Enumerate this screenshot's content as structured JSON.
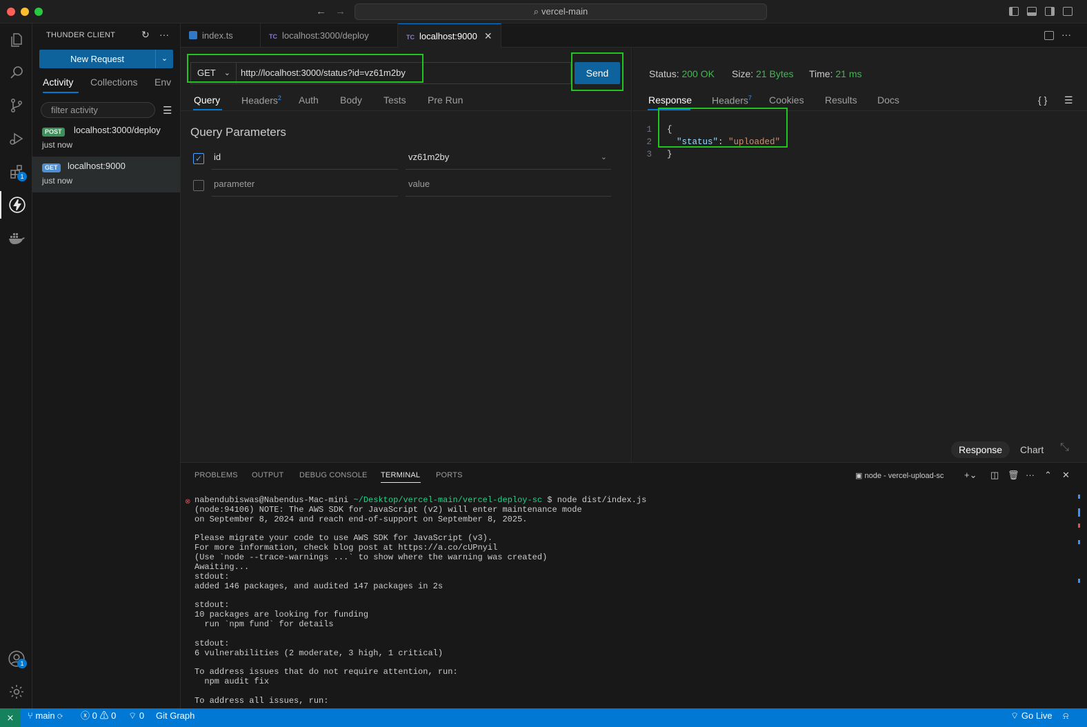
{
  "window": {
    "title": "vercel-main"
  },
  "activity_bar": {
    "extensions_badge": "1",
    "accounts_badge": "1"
  },
  "sidebar": {
    "title": "THUNDER CLIENT",
    "new_request_label": "New Request",
    "tabs": [
      "Activity",
      "Collections",
      "Env"
    ],
    "filter_placeholder": "filter activity",
    "items": [
      {
        "method": "POST",
        "url": "localhost:3000/deploy",
        "time": "just now",
        "badge_color": "#3f8f5b"
      },
      {
        "method": "GET",
        "url": "localhost:9000",
        "time": "just now",
        "badge_color": "#4d8fd1"
      }
    ]
  },
  "editor_tabs": [
    {
      "icon": "typescript-file-icon",
      "label": "index.ts"
    },
    {
      "icon": "TC",
      "label": "localhost:3000/deploy"
    },
    {
      "icon": "TC",
      "label": "localhost:9000"
    }
  ],
  "request": {
    "method": "GET",
    "url": "http://localhost:3000/status?id=vz61m2by",
    "send_label": "Send",
    "tabs": [
      {
        "label": "Query",
        "count": ""
      },
      {
        "label": "Headers",
        "count": "2"
      },
      {
        "label": "Auth",
        "count": ""
      },
      {
        "label": "Body",
        "count": ""
      },
      {
        "label": "Tests",
        "count": ""
      },
      {
        "label": "Pre Run",
        "count": ""
      }
    ],
    "section_title": "Query Parameters",
    "params": [
      {
        "checked": true,
        "key": "id",
        "value": "vz61m2by"
      },
      {
        "checked": false,
        "key_placeholder": "parameter",
        "value_placeholder": "value"
      }
    ]
  },
  "response": {
    "status_label": "Status:",
    "status_value": "200 OK",
    "size_label": "Size:",
    "size_value": "21 Bytes",
    "time_label": "Time:",
    "time_value": "21 ms",
    "tabs": [
      {
        "label": "Response",
        "count": ""
      },
      {
        "label": "Headers",
        "count": "7"
      },
      {
        "label": "Cookies",
        "count": ""
      },
      {
        "label": "Results",
        "count": ""
      },
      {
        "label": "Docs",
        "count": ""
      }
    ],
    "format_icon": "{ }",
    "body_lines": [
      {
        "n": "1",
        "text": "{"
      },
      {
        "n": "2",
        "key": "\"status\"",
        "value": "\"uploaded\""
      },
      {
        "n": "3",
        "text": "}"
      }
    ],
    "view_response_label": "Response",
    "view_chart_label": "Chart"
  },
  "panel": {
    "tabs": [
      "PROBLEMS",
      "OUTPUT",
      "DEBUG CONSOLE",
      "TERMINAL",
      "PORTS"
    ],
    "terminal_name": "node - vercel-upload-sc",
    "prompt_user": "nabendubiswas@Nabendus-Mac-mini",
    "prompt_path": "~/Desktop/vercel-main/vercel-deploy-sc",
    "prompt_cmd": "$ node dist/index.js",
    "lines": [
      "(node:94106) NOTE: The AWS SDK for JavaScript (v2) will enter maintenance mode",
      "on September 8, 2024 and reach end-of-support on September 8, 2025.",
      "",
      "Please migrate your code to use AWS SDK for JavaScript (v3).",
      "For more information, check blog post at https://a.co/cUPnyil",
      "(Use `node --trace-warnings ...` to show where the warning was created)",
      "Awaiting...",
      "stdout:",
      "added 146 packages, and audited 147 packages in 2s",
      "",
      "stdout:",
      "10 packages are looking for funding",
      "  run `npm fund` for details",
      "",
      "stdout:",
      "6 vulnerabilities (2 moderate, 3 high, 1 critical)",
      "",
      "To address issues that do not require attention, run:",
      "  npm audit fix",
      "",
      "To address all issues, run:"
    ]
  },
  "statusbar": {
    "branch": "main",
    "errors": "0",
    "warnings": "0",
    "ports": "0",
    "git_graph": "Git Graph",
    "go_live": "Go Live"
  }
}
